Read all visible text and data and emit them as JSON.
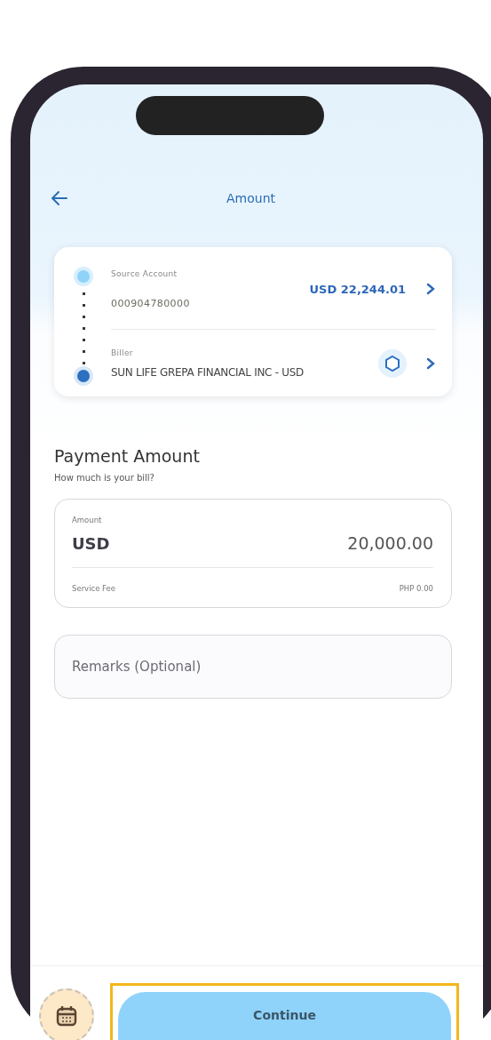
{
  "header": {
    "title": "Amount"
  },
  "transfer": {
    "source": {
      "label": "Source Account",
      "account": "000904780000",
      "balance": "USD 22,244.01"
    },
    "biller": {
      "label": "Biller",
      "name": "SUN LIFE GREPA FINANCIAL INC - USD"
    }
  },
  "payment": {
    "title": "Payment Amount",
    "subtitle": "How much is your bill?",
    "amount": {
      "label": "Amount",
      "currency": "USD",
      "value": "20,000.00",
      "fee_label": "Service Fee",
      "fee_value": "PHP 0.00"
    },
    "remarks": {
      "placeholder": "Remarks (Optional)"
    }
  },
  "footer": {
    "button": "Continue"
  }
}
